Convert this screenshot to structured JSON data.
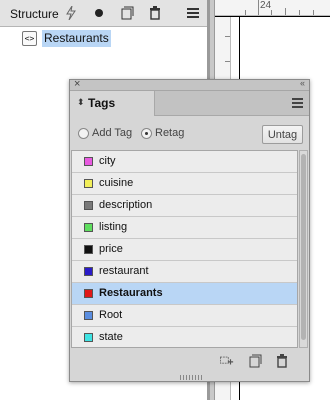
{
  "structure": {
    "title": "Structure",
    "tree": [
      {
        "icon": "xml-element-icon",
        "label": "Restaurants",
        "selected": true
      }
    ]
  },
  "ruler": {
    "top_label": "24"
  },
  "tags_panel": {
    "tab_label": "Tags",
    "options": {
      "add_tag": "Add Tag",
      "retag": "Retag",
      "selected_option": "Retag",
      "untag": "Untag"
    },
    "tags": [
      {
        "name": "city",
        "color": "#e85ae0"
      },
      {
        "name": "cuisine",
        "color": "#f2ef5a"
      },
      {
        "name": "description",
        "color": "#7a7a7a"
      },
      {
        "name": "listing",
        "color": "#5fde5f"
      },
      {
        "name": "price",
        "color": "#111111"
      },
      {
        "name": "restaurant",
        "color": "#2a1bc8"
      },
      {
        "name": "Restaurants",
        "color": "#e01818",
        "selected": true
      },
      {
        "name": "Root",
        "color": "#5b8ee0"
      },
      {
        "name": "state",
        "color": "#3fe3e3"
      }
    ]
  },
  "colors": {
    "selection": "#b9d6f5",
    "panel_bg": "#d6d6d6"
  }
}
